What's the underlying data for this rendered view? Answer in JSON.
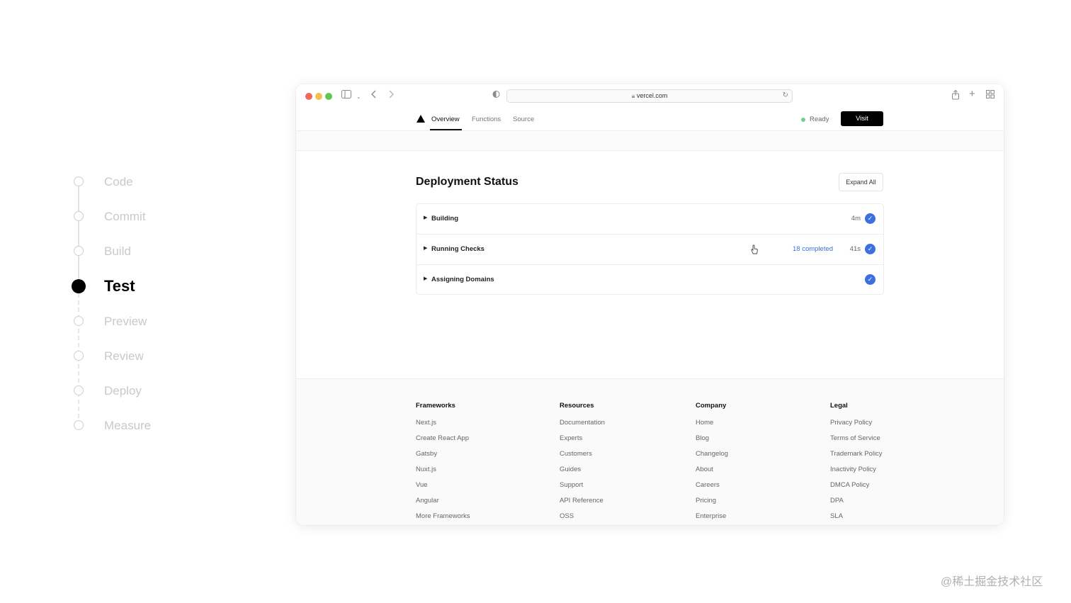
{
  "timeline": {
    "steps": [
      {
        "label": "Code",
        "active": false
      },
      {
        "label": "Commit",
        "active": false
      },
      {
        "label": "Build",
        "active": false
      },
      {
        "label": "Test",
        "active": true
      },
      {
        "label": "Preview",
        "active": false
      },
      {
        "label": "Review",
        "active": false
      },
      {
        "label": "Deploy",
        "active": false
      },
      {
        "label": "Measure",
        "active": false
      }
    ]
  },
  "browser": {
    "url": "vercel.com",
    "traffic_colors": [
      "#ec6a5e",
      "#f4bf4f",
      "#61c554"
    ]
  },
  "site_nav": {
    "tabs": [
      "Overview",
      "Functions",
      "Source"
    ],
    "active_tab": "Overview",
    "status": "Ready",
    "status_color": "#6fcf97",
    "visit_label": "Visit"
  },
  "deployment": {
    "title": "Deployment Status",
    "expand_label": "Expand All",
    "rows": [
      {
        "label": "Building",
        "link": "",
        "time": "4m"
      },
      {
        "label": "Running Checks",
        "link": "18 completed",
        "time": "41s"
      },
      {
        "label": "Assigning Domains",
        "link": "",
        "time": ""
      }
    ],
    "check_color": "#3e6fe0"
  },
  "footer": {
    "columns": [
      {
        "heading": "Frameworks",
        "links": [
          "Next.js",
          "Create React App",
          "Gatsby",
          "Nuxt.js",
          "Vue",
          "Angular",
          "More Frameworks"
        ]
      },
      {
        "heading": "Resources",
        "links": [
          "Documentation",
          "Experts",
          "Customers",
          "Guides",
          "Support",
          "API Reference",
          "OSS"
        ]
      },
      {
        "heading": "Company",
        "links": [
          "Home",
          "Blog",
          "Changelog",
          "About",
          "Careers",
          "Pricing",
          "Enterprise"
        ]
      },
      {
        "heading": "Legal",
        "links": [
          "Privacy Policy",
          "Terms of Service",
          "Trademark Policy",
          "Inactivity Policy",
          "DMCA Policy",
          "DPA",
          "SLA"
        ]
      }
    ]
  },
  "watermark": "@稀土掘金技术社区"
}
